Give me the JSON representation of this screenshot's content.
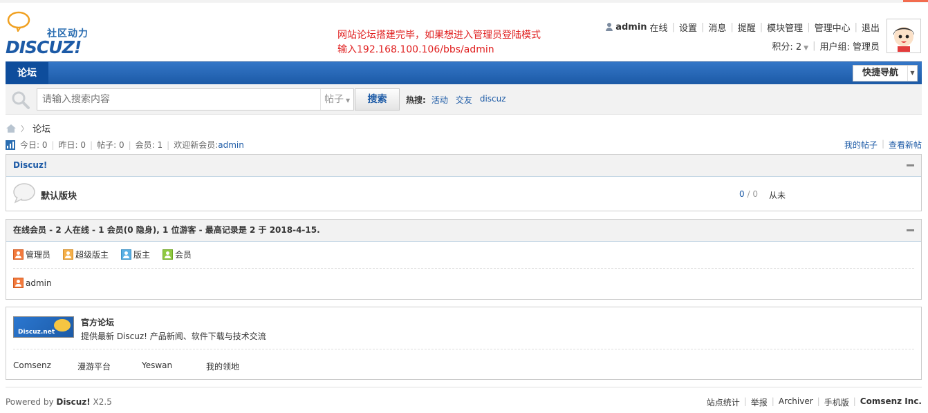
{
  "brand": {
    "slogan": "社区动力",
    "wordmark": "DISCUZ!"
  },
  "notice": {
    "line1": "网站论坛搭建完毕，如果想进入管理员登陆模式",
    "line2": "输入192.168.100.106/bbs/admin"
  },
  "userbar": {
    "username": "admin",
    "status": "在线",
    "links": [
      "设置",
      "消息",
      "提醒",
      "模块管理",
      "管理中心",
      "退出"
    ],
    "credits": "积分: 2",
    "usergroup": "用户组: 管理员"
  },
  "nav": {
    "tab": "论坛",
    "quicknav": "快捷导航"
  },
  "search": {
    "placeholder": "请输入搜索内容",
    "type": "帖子",
    "button": "搜索",
    "hot_label": "热搜:",
    "hot_words": [
      "活动",
      "交友",
      "discuz"
    ]
  },
  "breadcrumb": {
    "current": "论坛"
  },
  "stats": {
    "today": "今日: 0",
    "yesterday": "昨日: 0",
    "posts": "帖子: 0",
    "members": "会员: 1",
    "welcome_prefix": "欢迎新会员: ",
    "newest": "admin",
    "my_posts": "我的帖子",
    "new_posts": "查看新帖"
  },
  "category": {
    "title": "Discuz!",
    "forum_name": "默认版块",
    "threads": "0",
    "posts": "0",
    "last_post": "从未"
  },
  "online": {
    "title": "在线会员 - 2 人在线 - 1 会员(0 隐身), 1 位游客 - 最高记录是 2 于 2018-4-15.",
    "legend": [
      "管理员",
      "超级版主",
      "版主",
      "会员"
    ],
    "users": [
      "admin"
    ]
  },
  "links": {
    "banner_text": "Discuz.net",
    "official_title": "官方论坛",
    "official_desc": "提供最新 Discuz! 产品新闻、软件下载与技术交流",
    "text_links": [
      "Comsenz",
      "漫游平台",
      "Yeswan",
      "我的领地"
    ]
  },
  "footer": {
    "powered_prefix": "Powered by ",
    "powered_brand": "Discuz!",
    "version": " X2.5",
    "links": [
      "站点统计",
      "举报",
      "Archiver",
      "手机版"
    ],
    "company": "Comsenz Inc."
  },
  "colors": {
    "brand_blue": "#1c5aa6",
    "notice_red": "#e02020",
    "nav_blue": "#2a6db1"
  }
}
